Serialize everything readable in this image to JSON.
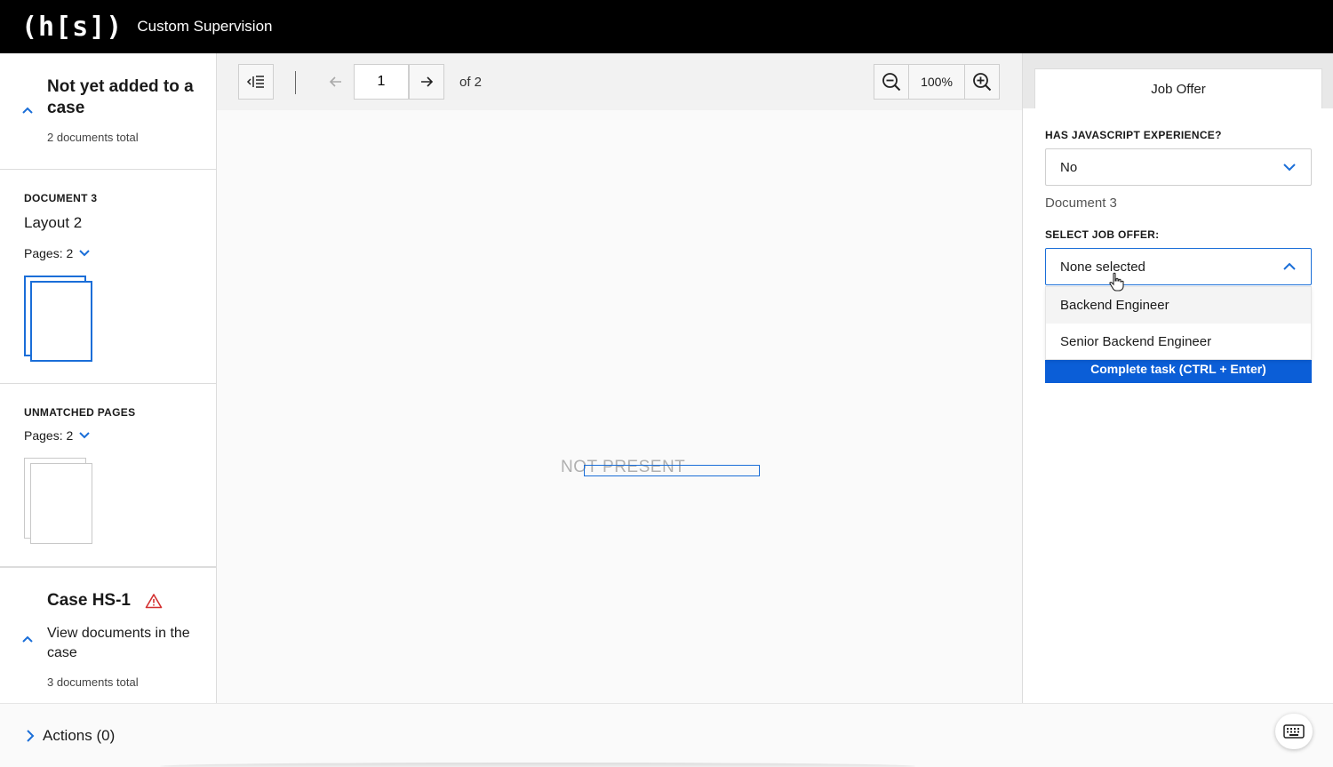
{
  "header": {
    "logo": "(h[s])",
    "title": "Custom Supervision"
  },
  "sidebar": {
    "group": {
      "title": "Not yet added to a case",
      "subtitle": "2 documents total"
    },
    "document": {
      "label": "DOCUMENT 3",
      "name": "Layout 2",
      "pages": "Pages: 2"
    },
    "unmatched": {
      "label": "UNMATCHED PAGES",
      "pages": "Pages: 2"
    },
    "case": {
      "title": "Case HS-1",
      "description": "View documents in the case",
      "subtitle": "3 documents total"
    }
  },
  "viewer": {
    "page_value": "1",
    "page_total": "of 2",
    "zoom": "100%",
    "placeholder": "NOT PRESENT"
  },
  "panel": {
    "tab": "Job Offer",
    "field1": {
      "label": "HAS JAVASCRIPT EXPERIENCE?",
      "value": "No"
    },
    "doc_ref": "Document 3",
    "field2": {
      "label": "SELECT JOB OFFER:",
      "value": "None selected",
      "options": [
        "Backend Engineer",
        "Senior Backend Engineer"
      ]
    },
    "complete_button": "Complete task (CTRL + Enter)"
  },
  "footer": {
    "actions": "Actions (0)"
  },
  "colors": {
    "accent": "#1a6ed8",
    "button": "#0b5ed7",
    "warning": "#d32f2f"
  }
}
